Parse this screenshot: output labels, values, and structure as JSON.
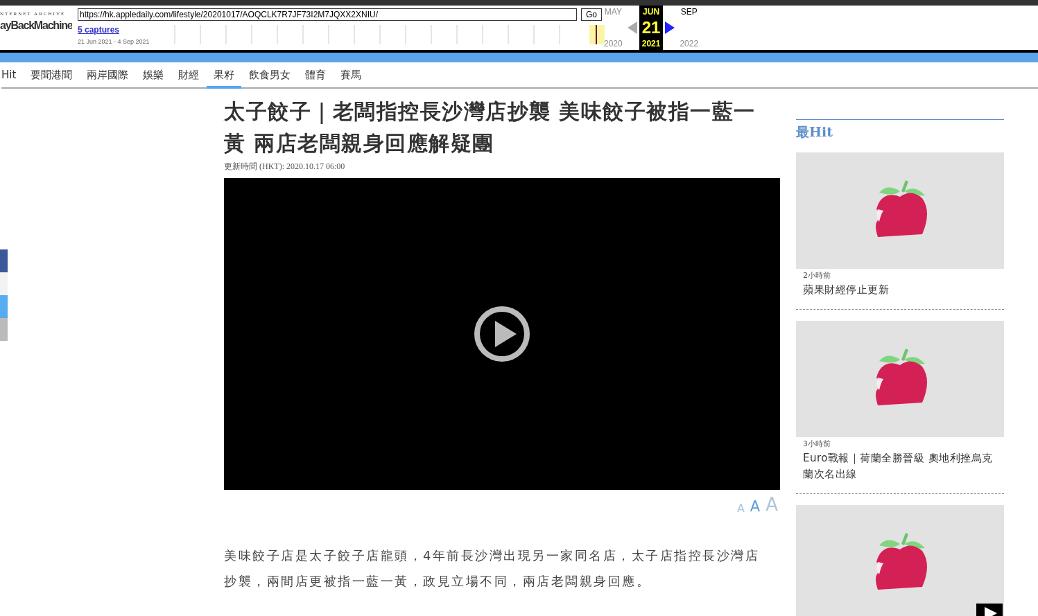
{
  "wayback": {
    "logo_top": "NTERNET ARCHIVE",
    "logo": "ayBackMachine",
    "url": "https://hk.appledaily.com/lifestyle/20201017/AOQCLK7R7JF73I2M7JQXX2XNIU/",
    "go": "Go",
    "captures": "5 captures",
    "range": "21 Jun 2021 - 4 Sep 2021",
    "months": [
      {
        "month": "MAY",
        "year": "2020",
        "selected": false
      },
      {
        "month": "JUN",
        "year": "2021",
        "selected": true
      },
      {
        "month": "SEP",
        "year": "2022",
        "selected": false
      }
    ],
    "day": "21"
  },
  "nav": [
    {
      "label": "Hit",
      "selected": false
    },
    {
      "label": "要聞港聞",
      "selected": false
    },
    {
      "label": "兩岸國際",
      "selected": false
    },
    {
      "label": "娛樂",
      "selected": false
    },
    {
      "label": "財經",
      "selected": false
    },
    {
      "label": "果籽",
      "selected": true
    },
    {
      "label": "飲食男女",
      "selected": false
    },
    {
      "label": "體育",
      "selected": false
    },
    {
      "label": "賽馬",
      "selected": false
    }
  ],
  "social": [
    {
      "color": "#3b5998"
    },
    {
      "color": "#f2f2f2"
    },
    {
      "color": "#55acee"
    },
    {
      "color": "#bbbbbb"
    }
  ],
  "article": {
    "title": "太子餃子｜老闆指控長沙灣店抄襲 美味餃子被指一藍一黃 兩店老闆親身回應解疑團",
    "updated": "更新時間 (HKT): 2020.10.17 06:00",
    "font_sizes": [
      {
        "label": "A",
        "selected": false
      },
      {
        "label": "A",
        "selected": true
      },
      {
        "label": "A",
        "selected": false
      }
    ],
    "body": "美味餃子店是太子餃子店龍頭，4年前長沙灣出現另一家同名店，太子店指控長沙灣店抄襲，兩間店更被指一藍一黃，政見立場不同，兩店老闆親身回應。"
  },
  "sidebar": {
    "title": "最Hit",
    "items": [
      {
        "time": "2小時前",
        "title": "蘋果財經停止更新",
        "video": false
      },
      {
        "time": "3小時前",
        "title": "Euro戰報｜荷蘭全勝晉級 奧地利挫烏克蘭次名出線",
        "video": false
      },
      {
        "video": true
      }
    ]
  }
}
